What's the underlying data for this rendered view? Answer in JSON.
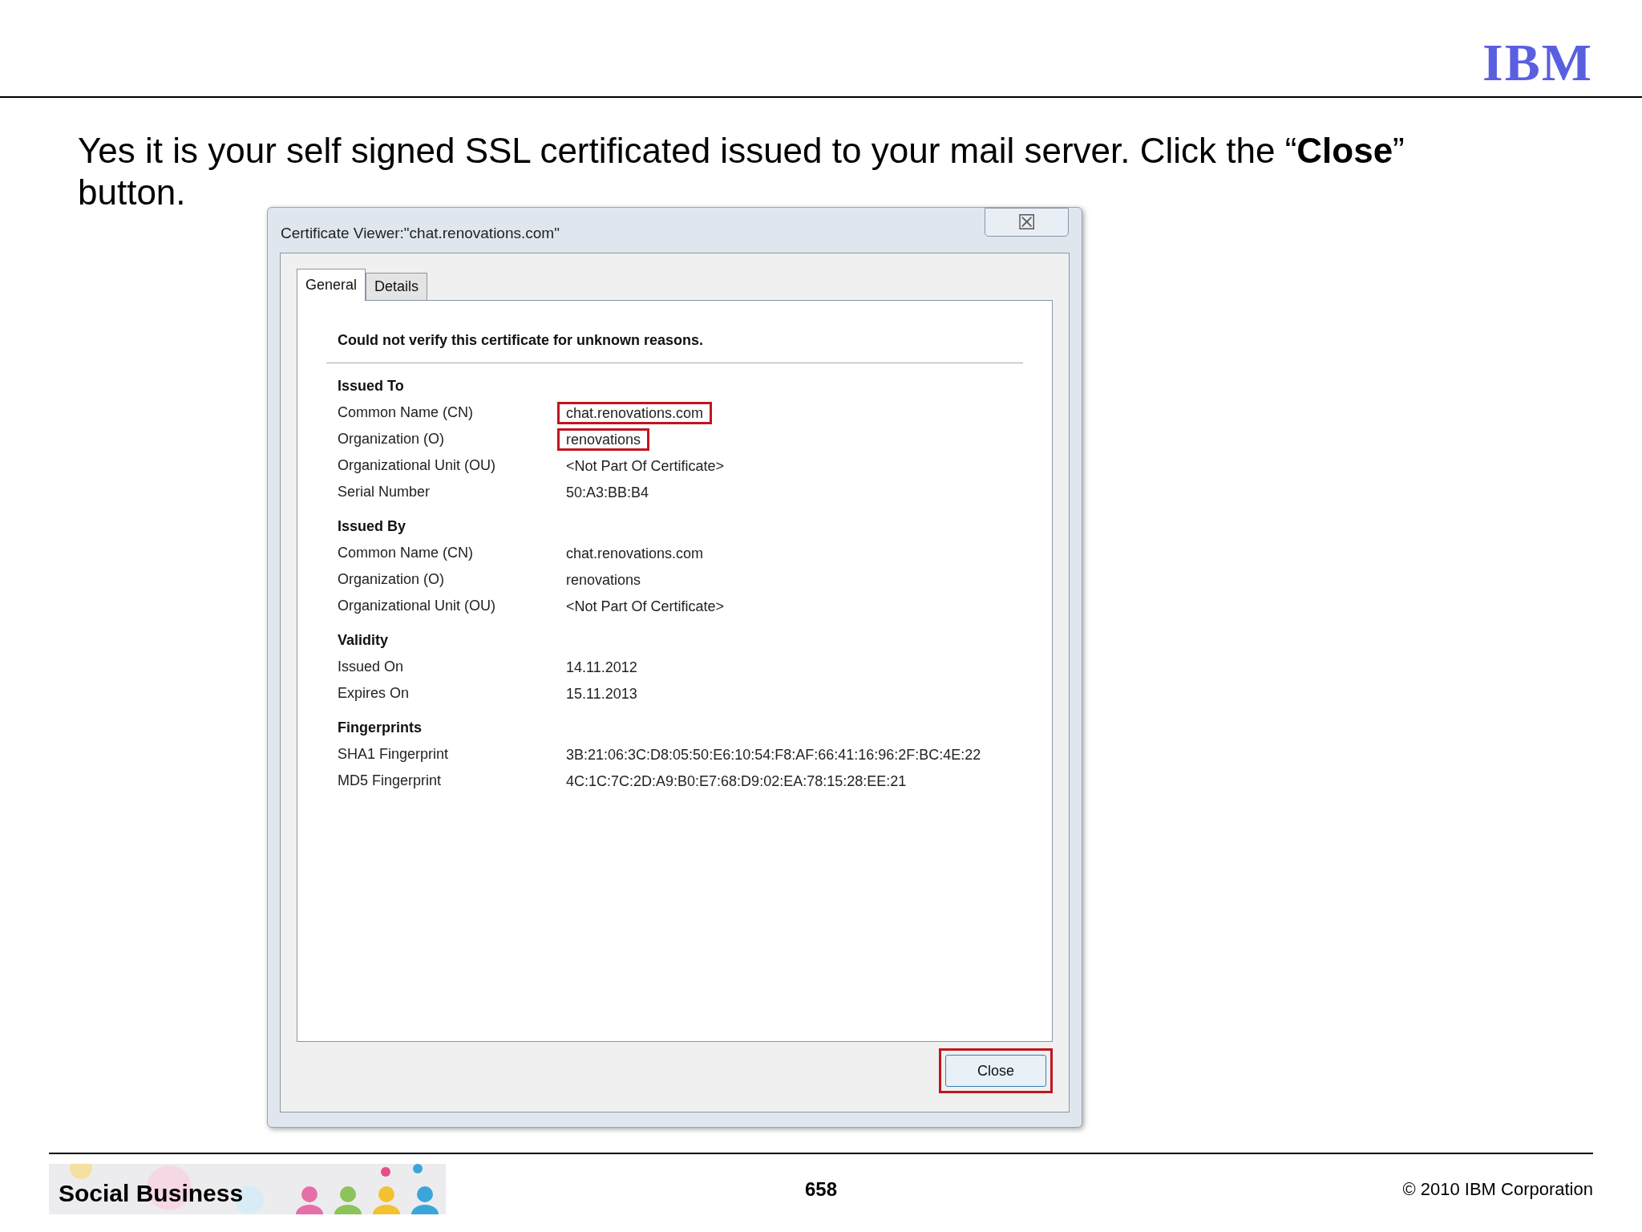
{
  "logo": {
    "text": "IBM"
  },
  "headline": "Yes it is your self signed SSL certificated issued to your mail server. Click the “**Close**” button.",
  "dialog": {
    "title": "Certificate Viewer:\"chat.renovations.com\"",
    "close_glyph": "☒",
    "tabs": [
      {
        "label": "General",
        "selected": true
      },
      {
        "label": "Details",
        "selected": false
      }
    ],
    "message": "Could not verify this certificate for unknown reasons.",
    "sections": [
      {
        "title": "Issued To",
        "rows": [
          {
            "label": "Common Name (CN)",
            "value": "chat.renovations.com",
            "highlighted": true
          },
          {
            "label": "Organization (O)",
            "value": "renovations",
            "highlighted": true
          },
          {
            "label": "Organizational Unit (OU)",
            "value": "<Not Part Of Certificate>",
            "highlighted": false
          },
          {
            "label": "Serial Number",
            "value": "50:A3:BB:B4",
            "highlighted": false
          }
        ]
      },
      {
        "title": "Issued By",
        "rows": [
          {
            "label": "Common Name (CN)",
            "value": "chat.renovations.com",
            "highlighted": false
          },
          {
            "label": "Organization (O)",
            "value": "renovations",
            "highlighted": false
          },
          {
            "label": "Organizational Unit (OU)",
            "value": "<Not Part Of Certificate>",
            "highlighted": false
          }
        ]
      },
      {
        "title": "Validity",
        "rows": [
          {
            "label": "Issued On",
            "value": "14.11.2012",
            "highlighted": false
          },
          {
            "label": "Expires On",
            "value": "15.11.2013",
            "highlighted": false
          }
        ]
      },
      {
        "title": "Fingerprints",
        "rows": [
          {
            "label": "SHA1 Fingerprint",
            "value": "3B:21:06:3C:D8:05:50:E6:10:54:F8:AF:66:41:16:96:2F:BC:4E:22",
            "highlighted": false
          },
          {
            "label": "MD5 Fingerprint",
            "value": "4C:1C:7C:2D:A9:B0:E7:68:D9:02:EA:78:15:28:EE:21",
            "highlighted": false
          }
        ]
      }
    ],
    "button": {
      "label": "Close",
      "highlighted": true
    }
  },
  "footer": {
    "banner_text": "Social Business",
    "page_number": "658",
    "copyright": "© 2010 IBM Corporation"
  }
}
